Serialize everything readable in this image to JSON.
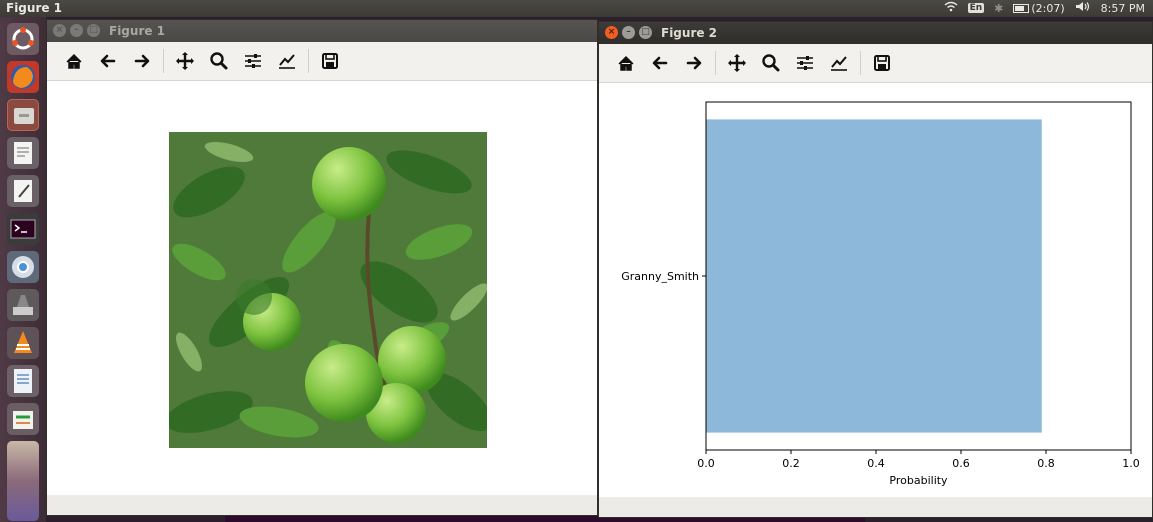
{
  "top_panel": {
    "active_app": "Figure 1",
    "keyboard_layout": "En",
    "battery": {
      "text": "(2:07)",
      "level": 0.7
    },
    "clock": "8:57 PM"
  },
  "launcher": {
    "icons": [
      "ubuntu-dash-icon",
      "firefox-icon",
      "files-icon",
      "text-editor-icon",
      "text-editor-2-icon",
      "terminal-icon",
      "chrome-icon",
      "system-settings-icon",
      "vlc-icon",
      "document-icon",
      "software-center-icon",
      "app-stack-icon"
    ]
  },
  "figure1": {
    "title": "Figure 1",
    "toolbar": [
      "home-icon",
      "back-icon",
      "forward-icon",
      "pan-icon",
      "zoom-icon",
      "configure-subplots-icon",
      "edit-axis-icon",
      "save-icon"
    ],
    "image_alt": "Green Granny Smith apples on a tree branch"
  },
  "figure2": {
    "title": "Figure 2",
    "toolbar": [
      "home-icon",
      "back-icon",
      "forward-icon",
      "pan-icon",
      "zoom-icon",
      "configure-subplots-icon",
      "edit-axis-icon",
      "save-icon"
    ]
  },
  "chart_data": {
    "type": "bar",
    "orientation": "horizontal",
    "categories": [
      "Granny_Smith"
    ],
    "values": [
      0.79
    ],
    "xlabel": "Probability",
    "ylabel": "",
    "xlim": [
      0,
      1.0
    ],
    "x_ticks": [
      "0.0",
      "0.2",
      "0.4",
      "0.6",
      "0.8",
      "1.0"
    ],
    "bar_color": "#8db8d9",
    "grid": false
  }
}
